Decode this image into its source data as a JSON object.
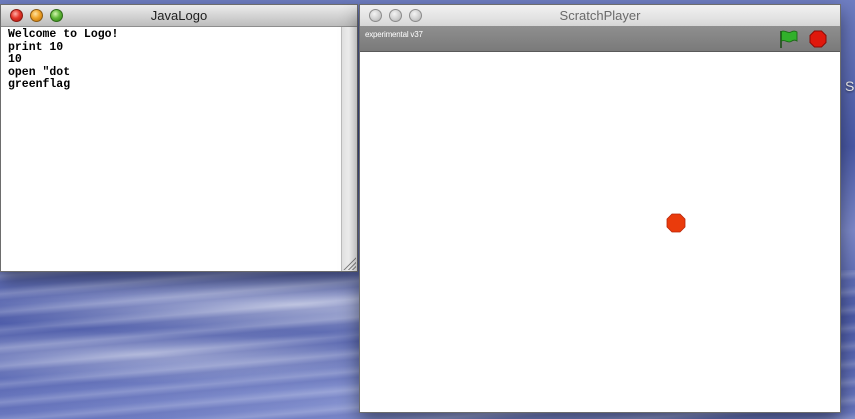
{
  "desktop": {
    "edge_glyph": "S"
  },
  "logo_window": {
    "title": "JavaLogo",
    "console_lines": [
      "Welcome to Logo!",
      "print 10",
      "10",
      "open \"dot",
      "greenflag"
    ]
  },
  "scratch_window": {
    "title": "ScratchPlayer",
    "version_label": "experimental v37",
    "green_flag_icon": "green-flag-icon",
    "stop_icon": "stop-sign-icon",
    "sprite": "red-octagon-dot"
  },
  "colors": {
    "flag_green": "#2fa82a",
    "stop_red": "#e0180c",
    "sprite_red": "#e83a0c",
    "toolbar_gray": "#858585"
  }
}
